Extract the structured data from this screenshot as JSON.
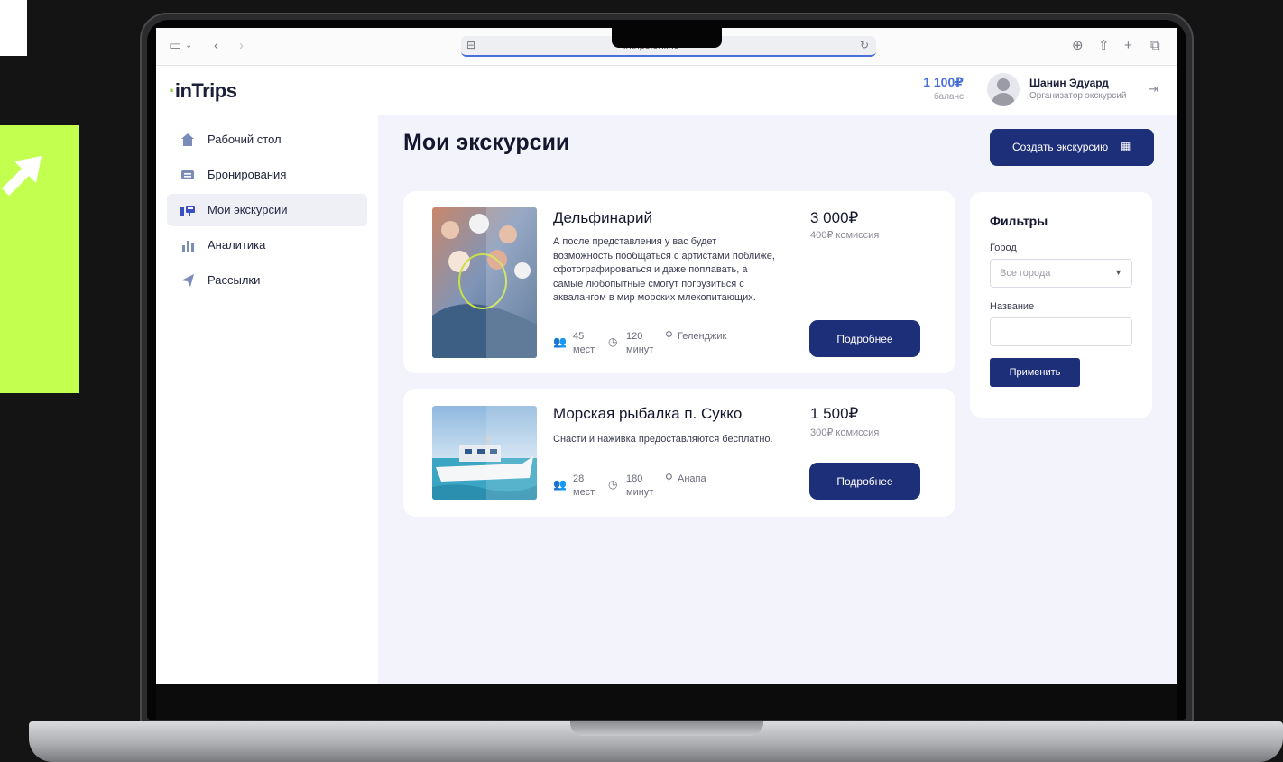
{
  "browser": {
    "url": "intrips.online"
  },
  "header": {
    "logo": "inTrips",
    "balance_value": "1 100₽",
    "balance_label": "баланс",
    "user_name": "Шанин Эдуард",
    "user_role": "Организатор экскурсий"
  },
  "sidebar": {
    "items": [
      {
        "label": "Рабочий стол",
        "icon": "home-icon"
      },
      {
        "label": "Бронирования",
        "icon": "bookings-icon"
      },
      {
        "label": "Мои экскурсии",
        "icon": "tours-icon",
        "active": true
      },
      {
        "label": "Аналитика",
        "icon": "chart-icon"
      },
      {
        "label": "Рассылки",
        "icon": "send-icon"
      }
    ]
  },
  "main": {
    "title": "Мои экскурсии",
    "create_button": "Создать экскурсию",
    "tours": [
      {
        "title": "Дельфинарий",
        "description": "А после представления у вас будет возможность пообщаться с артистами поближе, сфотографироваться и даже поплавать, а самые любопытные смогут погрузиться с аквалангом в мир морских млекопитающих.",
        "price": "3 000₽",
        "commission": "400₽ комиссия",
        "seats_value": "45",
        "seats_unit": "мест",
        "duration_value": "120",
        "duration_unit": "минут",
        "city": "Геленджик",
        "button": "Подробнее"
      },
      {
        "title": "Морская рыбалка п. Сукко",
        "description": "Снасти и наживка предоставляются бесплатно.",
        "price": "1 500₽",
        "commission": "300₽ комиссия",
        "seats_value": "28",
        "seats_unit": "мест",
        "duration_value": "180",
        "duration_unit": "минут",
        "city": "Анапа",
        "button": "Подробнее"
      }
    ]
  },
  "filters": {
    "title": "Фильтры",
    "city_label": "Город",
    "city_value": "Все города",
    "name_label": "Название",
    "name_value": "",
    "apply_button": "Применить"
  },
  "colors": {
    "accent": "#1e2f7a",
    "balance": "#4a6fd8",
    "deco_green": "#c2ff4f",
    "background": "#141414"
  }
}
